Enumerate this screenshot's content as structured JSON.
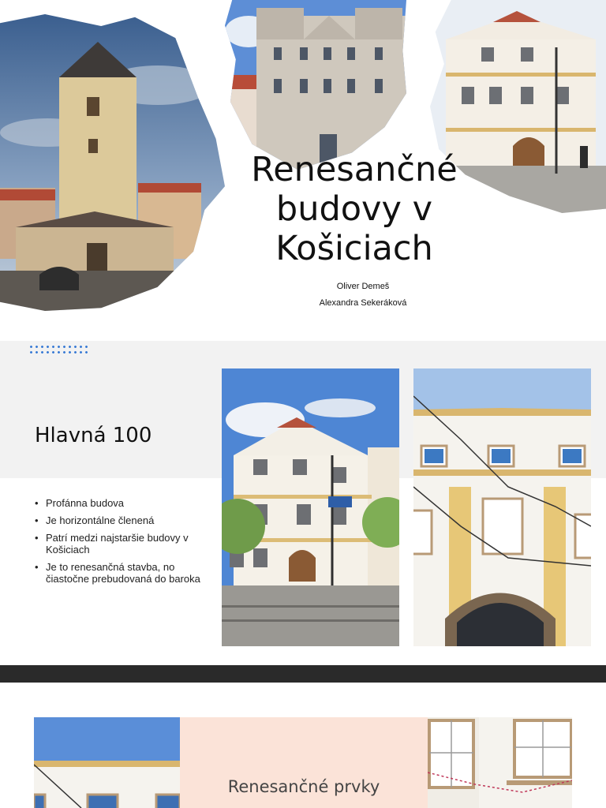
{
  "slide1": {
    "title": "Renesančné budovy v Košiciach",
    "authors": [
      "Oliver Demeš",
      "Alexandra Sekeráková"
    ]
  },
  "slide2": {
    "heading": "Hlavná 100",
    "bullets": [
      "Profánna budova",
      "Je horizontálne členená",
      "Patrí medzi najstaršie budovy v Košiciach",
      "Je to renesančná stavba, no čiastočne prebudovaná do baroka"
    ]
  },
  "slide3": {
    "heading": "Renesančné prvky"
  },
  "colors": {
    "accent_dots": "#3a7bd5",
    "band": "#f2f2f2",
    "separator": "#2a2a2a",
    "peach": "#fbe3d8"
  }
}
